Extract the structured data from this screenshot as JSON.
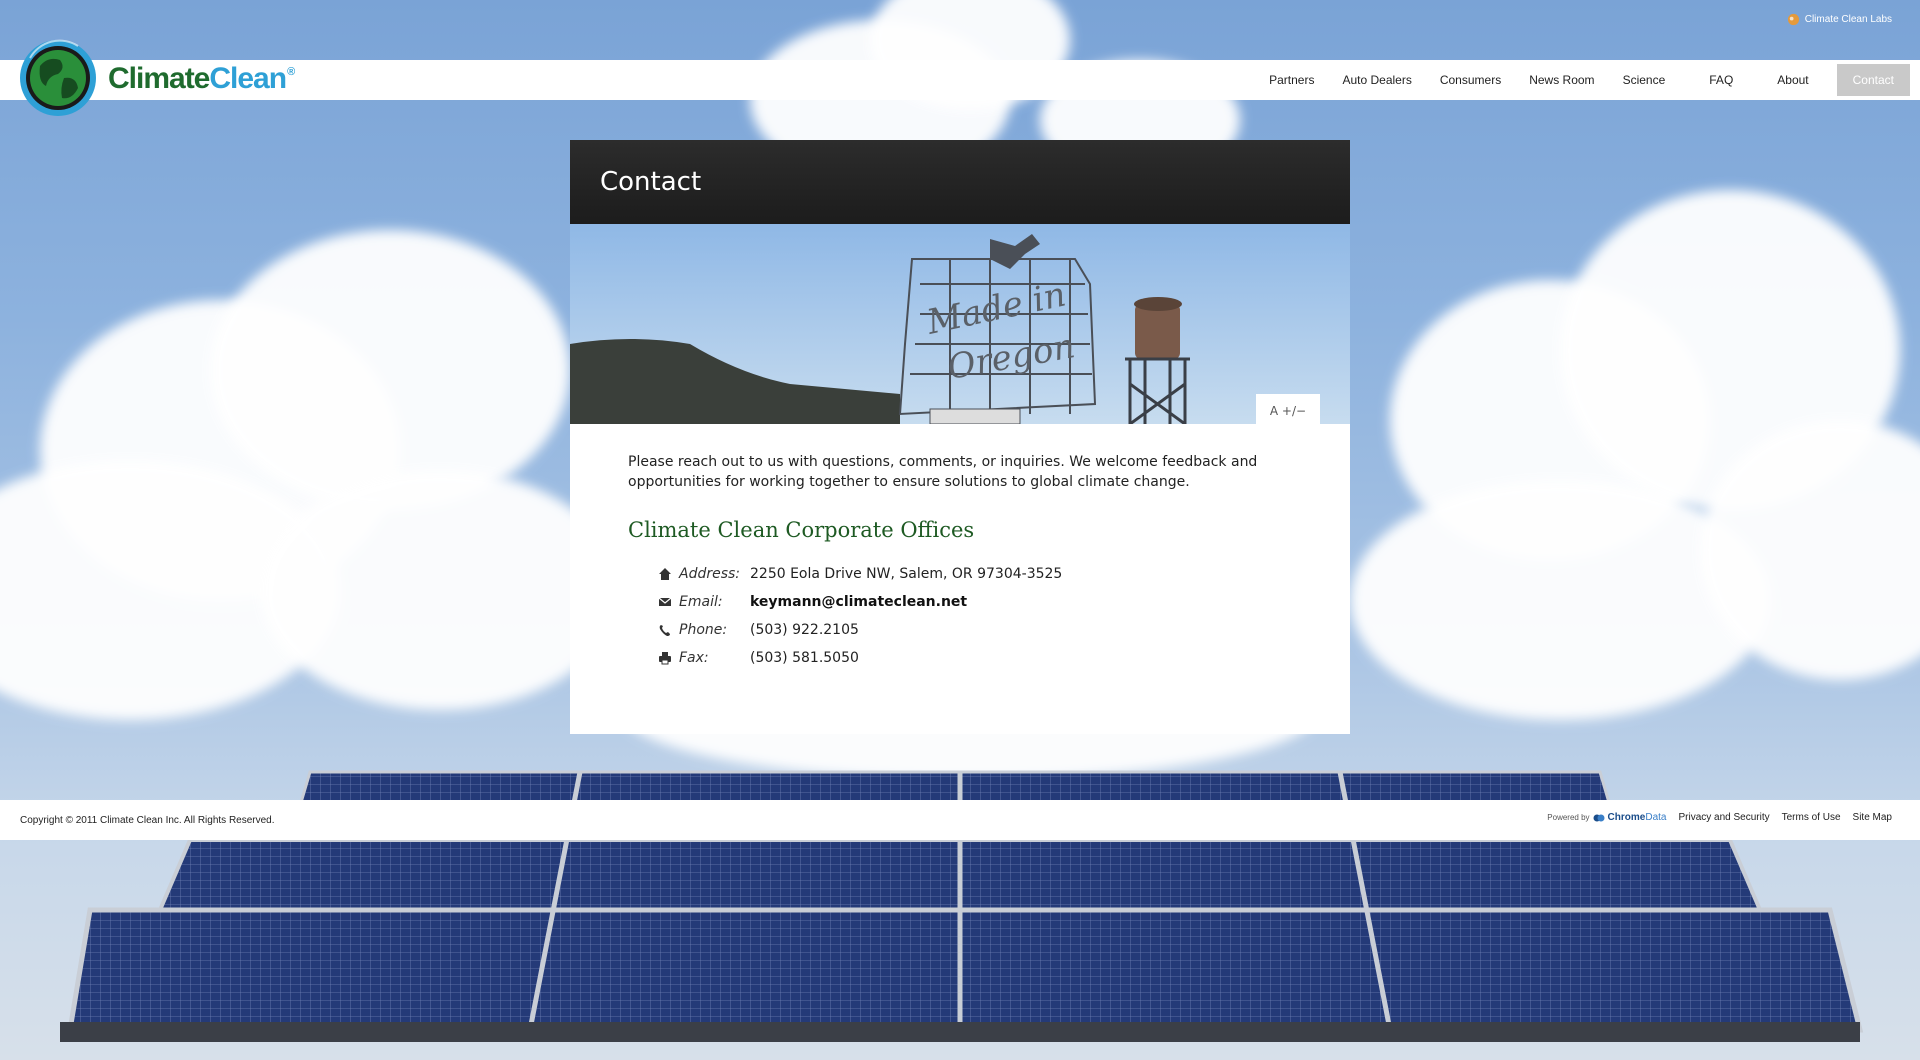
{
  "top": {
    "labs_link": "Climate Clean Labs"
  },
  "brand": {
    "name_part1": "Climate",
    "name_part2": "Clean",
    "registered": "®"
  },
  "nav": {
    "items": [
      {
        "label": "Partners"
      },
      {
        "label": "Auto Dealers"
      },
      {
        "label": "Consumers"
      },
      {
        "label": "News Room"
      },
      {
        "label": "Science"
      },
      {
        "label": "FAQ"
      },
      {
        "label": "About"
      },
      {
        "label": "Contact",
        "active": true
      }
    ]
  },
  "page": {
    "title": "Contact",
    "font_toggle": "A +/−",
    "intro": "Please reach out to us with questions, comments, or inquiries. We welcome feedback and opportunities for working together to ensure solutions to global climate change.",
    "offices_heading": "Climate Clean Corporate Offices",
    "contact": {
      "address_label": "Address:",
      "address": "2250 Eola Drive NW, Salem, OR 97304-3525",
      "email_label": "Email:",
      "email": "keymann@climateclean.net",
      "phone_label": "Phone:",
      "phone": "(503) 922.2105",
      "fax_label": "Fax:",
      "fax": "(503) 581.5050"
    },
    "banner_image": "Made in Oregon sign with Old Town water tower"
  },
  "footer": {
    "copyright": "Copyright © 2011 Climate Clean Inc. All Rights Reserved.",
    "powered_by": "Powered by",
    "powered_brand_1": "Chrome",
    "powered_brand_2": "Data",
    "links": [
      {
        "label": "Privacy and Security"
      },
      {
        "label": "Terms of Use"
      },
      {
        "label": "Site Map"
      }
    ]
  },
  "colors": {
    "brand_green": "#1f6b2e",
    "brand_blue": "#2ea0d6",
    "heading_green": "#1e5a23",
    "nav_active_bg": "#c9c9c9",
    "panel_header_bg": "#222222"
  }
}
